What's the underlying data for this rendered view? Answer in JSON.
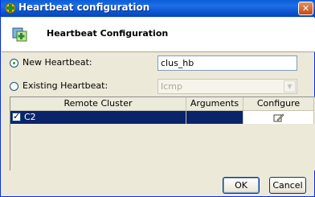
{
  "window": {
    "title": "Heartbeat configuration",
    "close_glyph": "✕"
  },
  "header": {
    "title": "Heartbeat Configuration",
    "icon": "heartbeat-config-icon"
  },
  "new_heartbeat": {
    "label": "New Heartbeat:",
    "value": "clus_hb",
    "selected": true
  },
  "existing_heartbeat": {
    "label": "Existing Heartbeat:",
    "value": "Icmp",
    "selected": false,
    "enabled": false
  },
  "table": {
    "columns": [
      "Remote Cluster",
      "Arguments",
      "Configure"
    ],
    "rows": [
      {
        "checked": true,
        "remote_cluster": "C2",
        "arguments": "",
        "configure_icon": "edit-icon"
      }
    ]
  },
  "buttons": {
    "ok": "OK",
    "cancel": "Cancel"
  }
}
